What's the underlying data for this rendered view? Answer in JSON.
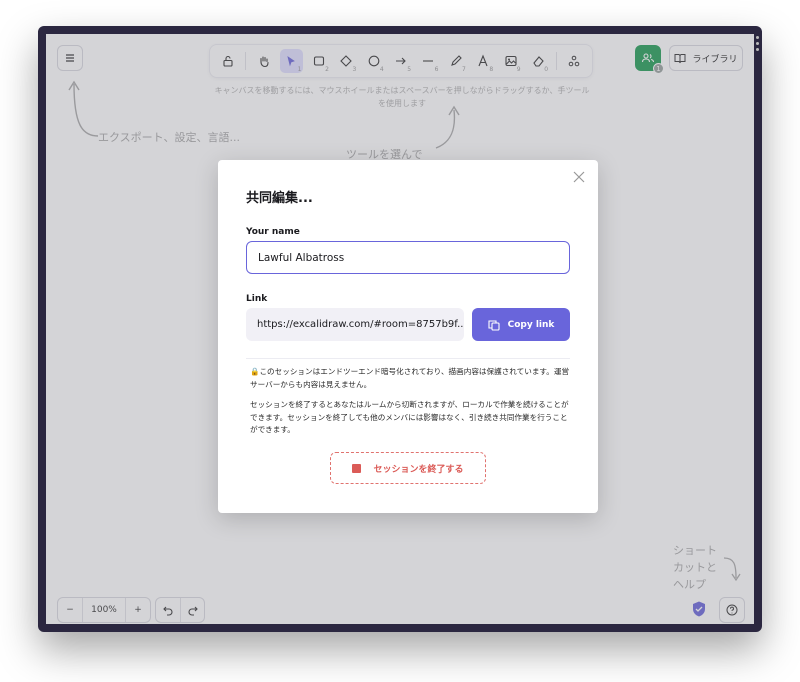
{
  "toolbar": {
    "tools": [
      {
        "name": "lock-icon",
        "shortcut": ""
      },
      {
        "name": "hand-icon",
        "shortcut": ""
      },
      {
        "name": "selection-icon",
        "shortcut": "1"
      },
      {
        "name": "rectangle-icon",
        "shortcut": "2"
      },
      {
        "name": "diamond-icon",
        "shortcut": "3"
      },
      {
        "name": "ellipse-icon",
        "shortcut": "4"
      },
      {
        "name": "arrow-icon",
        "shortcut": "5"
      },
      {
        "name": "line-icon",
        "shortcut": "6"
      },
      {
        "name": "pencil-icon",
        "shortcut": "7"
      },
      {
        "name": "text-icon",
        "shortcut": "8"
      },
      {
        "name": "image-icon",
        "shortcut": "9"
      },
      {
        "name": "eraser-icon",
        "shortcut": "0"
      },
      {
        "name": "extra-tools-icon",
        "shortcut": ""
      }
    ]
  },
  "header": {
    "collab_count": "1",
    "library_label": "ライブラリ"
  },
  "hints": {
    "top": "キャンバスを移動するには、マウスホイールまたはスペースバーを押しながらドラッグするか、手ツールを使用します",
    "menu": "エクスポート、設定、言語...",
    "tools": "ツールを選んで",
    "shortcut_line1": "ショート",
    "shortcut_line2": "カットと",
    "shortcut_line3": "ヘルプ"
  },
  "footer": {
    "zoom_out": "−",
    "zoom_value": "100%",
    "zoom_in": "+"
  },
  "dialog": {
    "title": "共同編集...",
    "name_label": "Your name",
    "name_value": "Lawful Albatross",
    "link_label": "Link",
    "link_value": "https://excalidraw.com/#room=8757b9f...",
    "copy_label": "Copy link",
    "privacy_text": "🔒このセッションはエンドツーエンド暗号化されており、描画内容は保護されています。運営サーバーからも内容は見えません。",
    "end_info_text": "セッションを終了するとあなたはルームから切断されますが、ローカルで作業を続けることができます。セッションを終了しても他のメンバには影響はなく、引き続き共同作業を行うことができます。",
    "end_session_label": "セッションを終了する"
  },
  "colors": {
    "accent": "#6965db",
    "danger": "#db5b57",
    "collab_green": "#1f9d55"
  }
}
